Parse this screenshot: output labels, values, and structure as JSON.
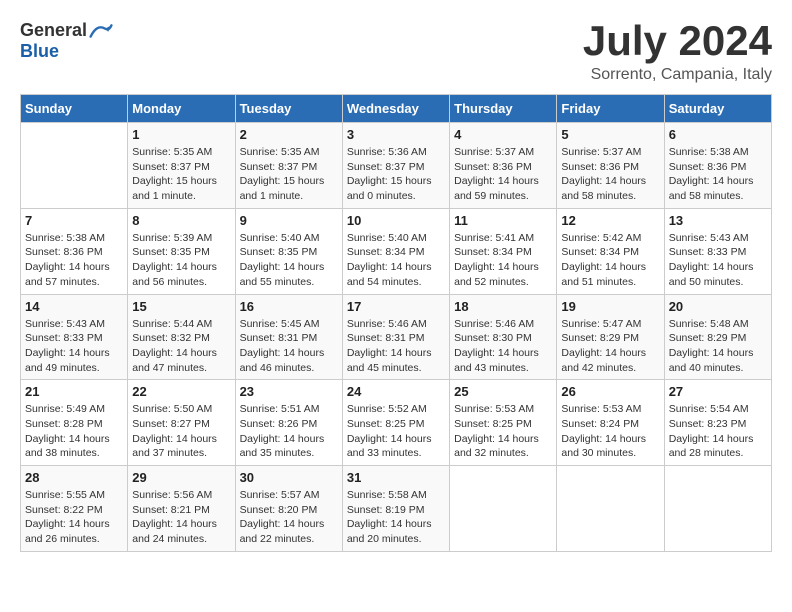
{
  "header": {
    "logo_general": "General",
    "logo_blue": "Blue",
    "month_title": "July 2024",
    "location": "Sorrento, Campania, Italy"
  },
  "days_of_week": [
    "Sunday",
    "Monday",
    "Tuesday",
    "Wednesday",
    "Thursday",
    "Friday",
    "Saturday"
  ],
  "weeks": [
    [
      {
        "day": "",
        "info": ""
      },
      {
        "day": "1",
        "info": "Sunrise: 5:35 AM\nSunset: 8:37 PM\nDaylight: 15 hours\nand 1 minute."
      },
      {
        "day": "2",
        "info": "Sunrise: 5:35 AM\nSunset: 8:37 PM\nDaylight: 15 hours\nand 1 minute."
      },
      {
        "day": "3",
        "info": "Sunrise: 5:36 AM\nSunset: 8:37 PM\nDaylight: 15 hours\nand 0 minutes."
      },
      {
        "day": "4",
        "info": "Sunrise: 5:37 AM\nSunset: 8:36 PM\nDaylight: 14 hours\nand 59 minutes."
      },
      {
        "day": "5",
        "info": "Sunrise: 5:37 AM\nSunset: 8:36 PM\nDaylight: 14 hours\nand 58 minutes."
      },
      {
        "day": "6",
        "info": "Sunrise: 5:38 AM\nSunset: 8:36 PM\nDaylight: 14 hours\nand 58 minutes."
      }
    ],
    [
      {
        "day": "7",
        "info": "Sunrise: 5:38 AM\nSunset: 8:36 PM\nDaylight: 14 hours\nand 57 minutes."
      },
      {
        "day": "8",
        "info": "Sunrise: 5:39 AM\nSunset: 8:35 PM\nDaylight: 14 hours\nand 56 minutes."
      },
      {
        "day": "9",
        "info": "Sunrise: 5:40 AM\nSunset: 8:35 PM\nDaylight: 14 hours\nand 55 minutes."
      },
      {
        "day": "10",
        "info": "Sunrise: 5:40 AM\nSunset: 8:34 PM\nDaylight: 14 hours\nand 54 minutes."
      },
      {
        "day": "11",
        "info": "Sunrise: 5:41 AM\nSunset: 8:34 PM\nDaylight: 14 hours\nand 52 minutes."
      },
      {
        "day": "12",
        "info": "Sunrise: 5:42 AM\nSunset: 8:34 PM\nDaylight: 14 hours\nand 51 minutes."
      },
      {
        "day": "13",
        "info": "Sunrise: 5:43 AM\nSunset: 8:33 PM\nDaylight: 14 hours\nand 50 minutes."
      }
    ],
    [
      {
        "day": "14",
        "info": "Sunrise: 5:43 AM\nSunset: 8:33 PM\nDaylight: 14 hours\nand 49 minutes."
      },
      {
        "day": "15",
        "info": "Sunrise: 5:44 AM\nSunset: 8:32 PM\nDaylight: 14 hours\nand 47 minutes."
      },
      {
        "day": "16",
        "info": "Sunrise: 5:45 AM\nSunset: 8:31 PM\nDaylight: 14 hours\nand 46 minutes."
      },
      {
        "day": "17",
        "info": "Sunrise: 5:46 AM\nSunset: 8:31 PM\nDaylight: 14 hours\nand 45 minutes."
      },
      {
        "day": "18",
        "info": "Sunrise: 5:46 AM\nSunset: 8:30 PM\nDaylight: 14 hours\nand 43 minutes."
      },
      {
        "day": "19",
        "info": "Sunrise: 5:47 AM\nSunset: 8:29 PM\nDaylight: 14 hours\nand 42 minutes."
      },
      {
        "day": "20",
        "info": "Sunrise: 5:48 AM\nSunset: 8:29 PM\nDaylight: 14 hours\nand 40 minutes."
      }
    ],
    [
      {
        "day": "21",
        "info": "Sunrise: 5:49 AM\nSunset: 8:28 PM\nDaylight: 14 hours\nand 38 minutes."
      },
      {
        "day": "22",
        "info": "Sunrise: 5:50 AM\nSunset: 8:27 PM\nDaylight: 14 hours\nand 37 minutes."
      },
      {
        "day": "23",
        "info": "Sunrise: 5:51 AM\nSunset: 8:26 PM\nDaylight: 14 hours\nand 35 minutes."
      },
      {
        "day": "24",
        "info": "Sunrise: 5:52 AM\nSunset: 8:25 PM\nDaylight: 14 hours\nand 33 minutes."
      },
      {
        "day": "25",
        "info": "Sunrise: 5:53 AM\nSunset: 8:25 PM\nDaylight: 14 hours\nand 32 minutes."
      },
      {
        "day": "26",
        "info": "Sunrise: 5:53 AM\nSunset: 8:24 PM\nDaylight: 14 hours\nand 30 minutes."
      },
      {
        "day": "27",
        "info": "Sunrise: 5:54 AM\nSunset: 8:23 PM\nDaylight: 14 hours\nand 28 minutes."
      }
    ],
    [
      {
        "day": "28",
        "info": "Sunrise: 5:55 AM\nSunset: 8:22 PM\nDaylight: 14 hours\nand 26 minutes."
      },
      {
        "day": "29",
        "info": "Sunrise: 5:56 AM\nSunset: 8:21 PM\nDaylight: 14 hours\nand 24 minutes."
      },
      {
        "day": "30",
        "info": "Sunrise: 5:57 AM\nSunset: 8:20 PM\nDaylight: 14 hours\nand 22 minutes."
      },
      {
        "day": "31",
        "info": "Sunrise: 5:58 AM\nSunset: 8:19 PM\nDaylight: 14 hours\nand 20 minutes."
      },
      {
        "day": "",
        "info": ""
      },
      {
        "day": "",
        "info": ""
      },
      {
        "day": "",
        "info": ""
      }
    ]
  ]
}
